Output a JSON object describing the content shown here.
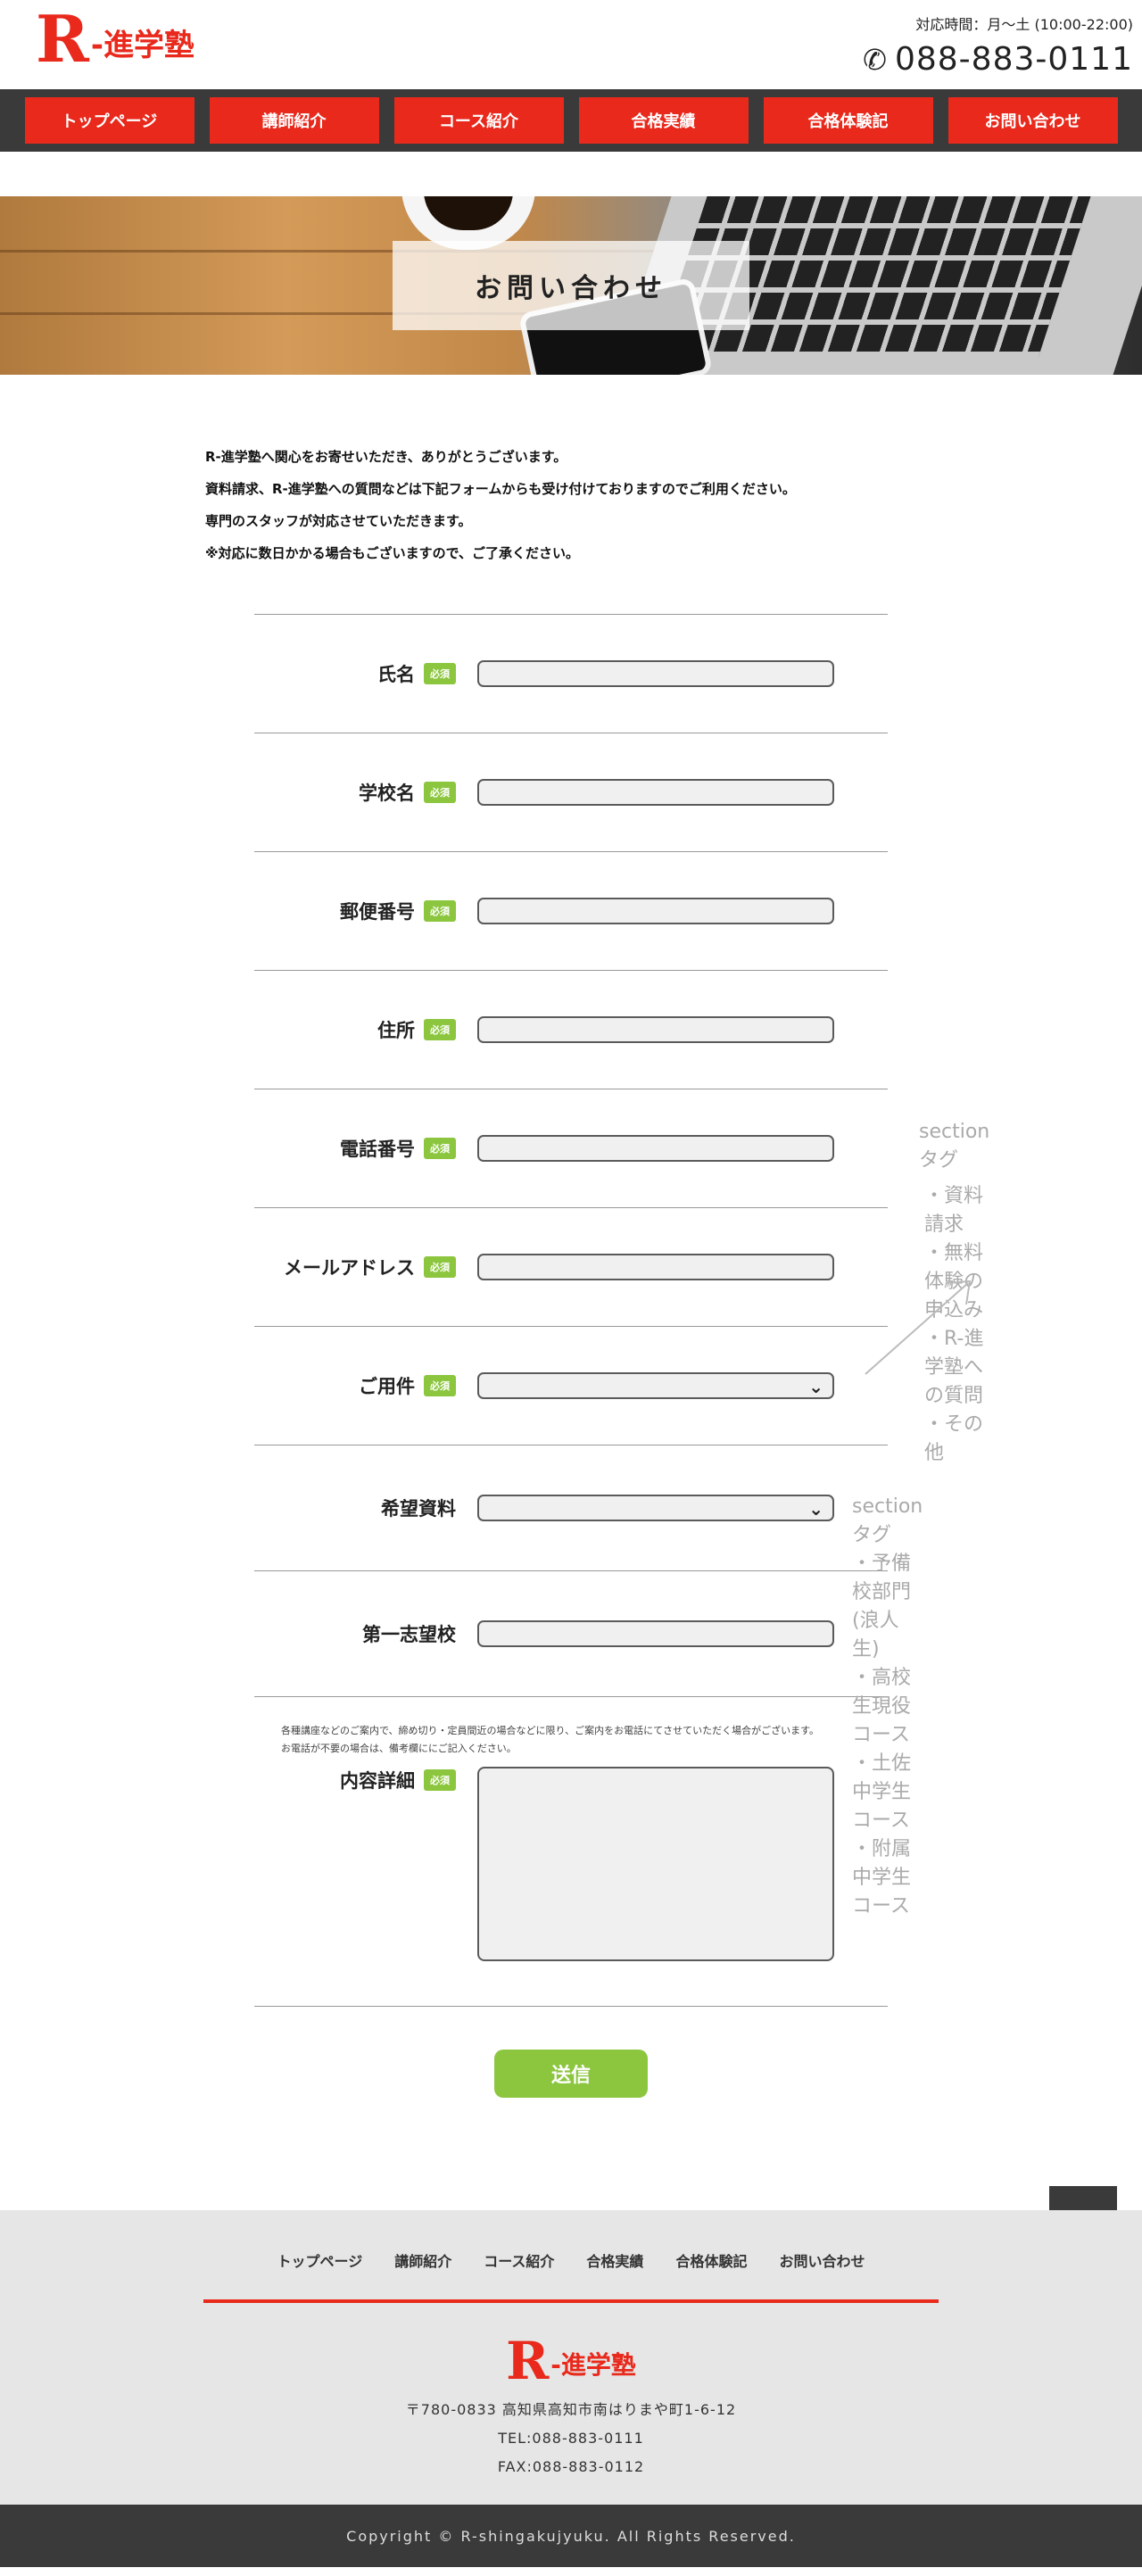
{
  "header": {
    "logo_r": "R",
    "logo_text": "-進学塾",
    "hours": "対応時間：月〜土 (10:00-22:00)",
    "phone": "088-883-0111"
  },
  "nav": [
    "トップページ",
    "講師紹介",
    "コース紹介",
    "合格実績",
    "合格体験記",
    "お問い合わせ"
  ],
  "hero": {
    "title": "お問い合わせ"
  },
  "intro": [
    "R-進学塾へ関心をお寄せいただき、ありがとうございます。",
    "資料請求、R-進学塾への質問などは下記フォームからも受け付けておりますのでご利用ください。",
    "専門のスタッフが対応させていただきます。",
    "※対応に数日かかる場合もございますので、ご了承ください。"
  ],
  "form": {
    "required_badge": "必須",
    "fields": [
      {
        "label": "氏名"
      },
      {
        "label": "学校名"
      },
      {
        "label": "郵便番号"
      },
      {
        "label": "住所"
      },
      {
        "label": "電話番号"
      },
      {
        "label": "メールアドレス"
      },
      {
        "label": "ご用件"
      },
      {
        "label": "希望資料"
      },
      {
        "label": "第一志望校"
      }
    ],
    "note_1": "各種講座などのご案内で、締め切り・定員間近の場合などに限り、ご案内をお電話にてさせていただく場合がございます。",
    "note_2": "お電話が不要の場合は、備考欄ににご記入ください。",
    "detail_label": "内容詳細",
    "submit": "送信"
  },
  "annotations": {
    "a1_title": "sectionタグ",
    "a1_items": [
      "・資料請求",
      "・無料体験の申込み",
      "・R-進学塾への質問",
      "・その他"
    ],
    "a2_title": "sectionタグ",
    "a2_items": [
      "・予備校部門(浪人生)",
      "・高校生現役コース",
      "・土佐中学生コース",
      "・附属中学生コース"
    ]
  },
  "footer": {
    "nav": [
      "トップページ",
      "講師紹介",
      "コース紹介",
      "合格実績",
      "合格体験記",
      "お問い合わせ"
    ],
    "address": "〒780-0833 高知県高知市南はりまや町1-6-12",
    "tel": "TEL:088-883-0111",
    "fax": "FAX:088-883-0112",
    "copyright": "Copyright © R-shingakujyuku. All Rights Reserved."
  }
}
